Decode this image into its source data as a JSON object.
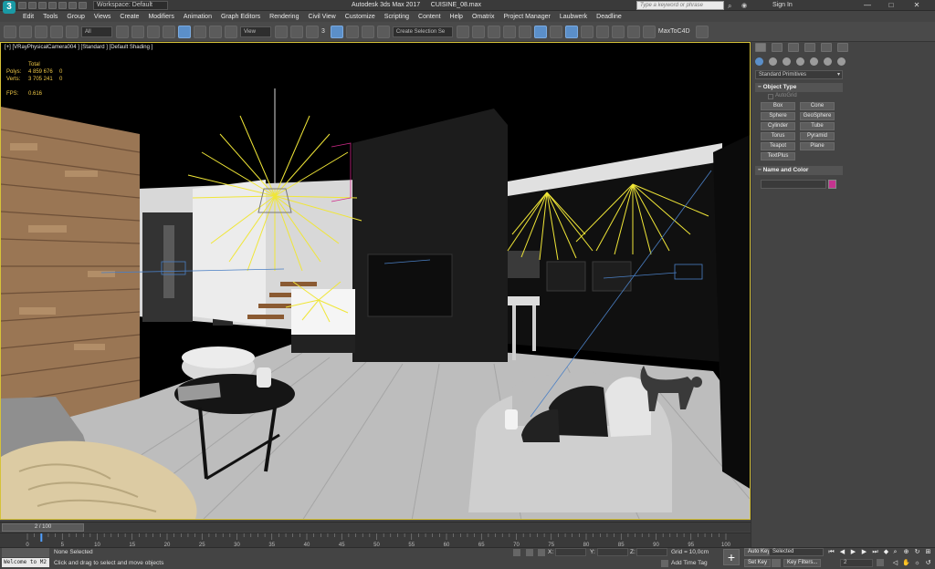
{
  "window": {
    "title": "Autodesk 3ds Max 2017",
    "file": "CUISINE_08.max",
    "workspace": "Workspace: Default",
    "search_placeholder": "Type a keyword or phrase",
    "sign_in": "Sign In"
  },
  "menu": [
    "Edit",
    "Tools",
    "Group",
    "Views",
    "Create",
    "Modifiers",
    "Animation",
    "Graph Editors",
    "Rendering",
    "Civil View",
    "Customize",
    "Scripting",
    "Content",
    "Help",
    "Omatrix",
    "Project Manager",
    "Laubwerk",
    "Deadline"
  ],
  "toolbar": {
    "filter": "All",
    "ref_coord": "View",
    "angle_snap": "3",
    "selection_set": "Create Selection Se",
    "maxtoc4d": "MaxToC4D"
  },
  "viewport": {
    "label": "[+] [VRayPhysicalCamera004 ] [Standard ] [Default Shading ]",
    "stats": {
      "header": "Total",
      "rows": [
        {
          "label": "Polys:",
          "value": "4 859 676",
          "sel": "0"
        },
        {
          "label": "Verts:",
          "value": "3 705 241",
          "sel": "0"
        }
      ],
      "fps_label": "FPS:",
      "fps_value": "0.616"
    }
  },
  "command_panel": {
    "category": "Standard Primitives",
    "object_type_header": "Object Type",
    "autogrid": "AutoGrid",
    "primitives": [
      "Box",
      "Cone",
      "Sphere",
      "GeoSphere",
      "Cylinder",
      "Tube",
      "Torus",
      "Pyramid",
      "Teapot",
      "Plane",
      "TextPlus"
    ],
    "name_color_header": "Name and Color",
    "swatch_color": "#c5338f"
  },
  "timeline": {
    "frame": "2 / 100",
    "ticks": [
      "0",
      "5",
      "10",
      "15",
      "20",
      "25",
      "30",
      "35",
      "40",
      "45",
      "50",
      "55",
      "60",
      "65",
      "70",
      "75",
      "80",
      "85",
      "90",
      "95",
      "100"
    ]
  },
  "status": {
    "maxscript": "Welcome to M2",
    "selection": "None Selected",
    "prompt": "Click and drag to select and move objects",
    "x_label": "X:",
    "y_label": "Y:",
    "z_label": "Z:",
    "grid": "Grid = 10,0cm",
    "add_time_tag": "Add Time Tag",
    "auto_key": "Auto Key",
    "set_key": "Set Key",
    "selected": "Selected",
    "key_filters": "Key Filters...",
    "frame_value": "2"
  }
}
